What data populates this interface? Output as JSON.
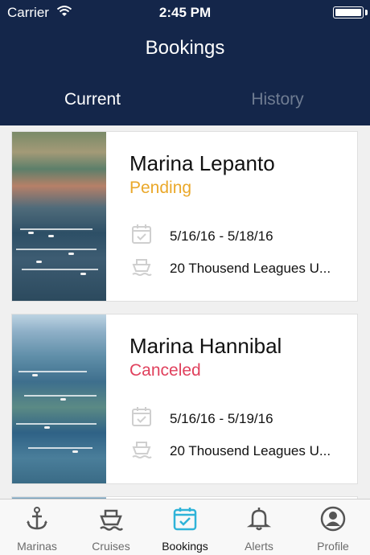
{
  "status_bar": {
    "carrier": "Carrier",
    "time": "2:45 PM"
  },
  "header": {
    "title": "Bookings"
  },
  "tabs": {
    "current": "Current",
    "history": "History"
  },
  "bookings": [
    {
      "name": "Marina Lepanto",
      "status": "Pending",
      "dates": "5/16/16 - 5/18/16",
      "vessel": "20 Thousend Leagues U..."
    },
    {
      "name": "Marina Hannibal",
      "status": "Canceled",
      "dates": "5/16/16 - 5/19/16",
      "vessel": "20 Thousend Leagues U..."
    }
  ],
  "tabbar": {
    "items": [
      {
        "label": "Marinas",
        "icon": "anchor-icon"
      },
      {
        "label": "Cruises",
        "icon": "ship-icon"
      },
      {
        "label": "Bookings",
        "icon": "calendar-check-icon",
        "active": true
      },
      {
        "label": "Alerts",
        "icon": "bell-icon"
      },
      {
        "label": "Profile",
        "icon": "user-icon"
      }
    ]
  },
  "colors": {
    "header_bg": "#14264a",
    "pending": "#eaa82a",
    "canceled": "#e0415d",
    "active_tab_icon": "#2fb3d8"
  }
}
